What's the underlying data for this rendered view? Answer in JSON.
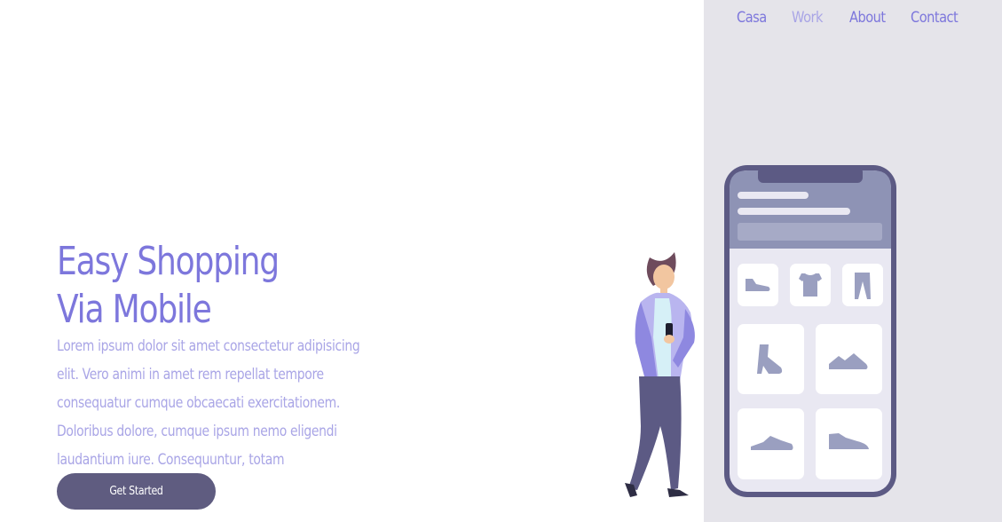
{
  "nav": {
    "items": [
      {
        "label": "Casa",
        "active": false
      },
      {
        "label": "Work",
        "active": true
      },
      {
        "label": "About",
        "active": false
      },
      {
        "label": "Contact",
        "active": false
      }
    ]
  },
  "hero": {
    "title_line1": "Easy Shopping",
    "title_line2": "Via Mobile",
    "description": "Lorem ipsum dolor sit amet consectetur adipisicing elit. Vero animi in amet rem repellat tempore consequatur cumque obcaecati exercitationem. Doloribus dolore, cumque ipsum nemo eligendi laudantium iure. Consequuntur, totam dignissimos?",
    "cta_label": "Get Started"
  },
  "colors": {
    "accent": "#7d77dc",
    "accent_light": "#a9a5e6",
    "button": "#5f5c80",
    "side_panel": "#e5e4ea"
  },
  "illustration": {
    "subject": "woman-with-smartphone-shopping-app",
    "product_icons": [
      "shoe-icon",
      "tshirt-icon",
      "pants-icon",
      "boot-icon",
      "sneaker-icon",
      "sneaker-icon",
      "sneaker-icon"
    ]
  }
}
